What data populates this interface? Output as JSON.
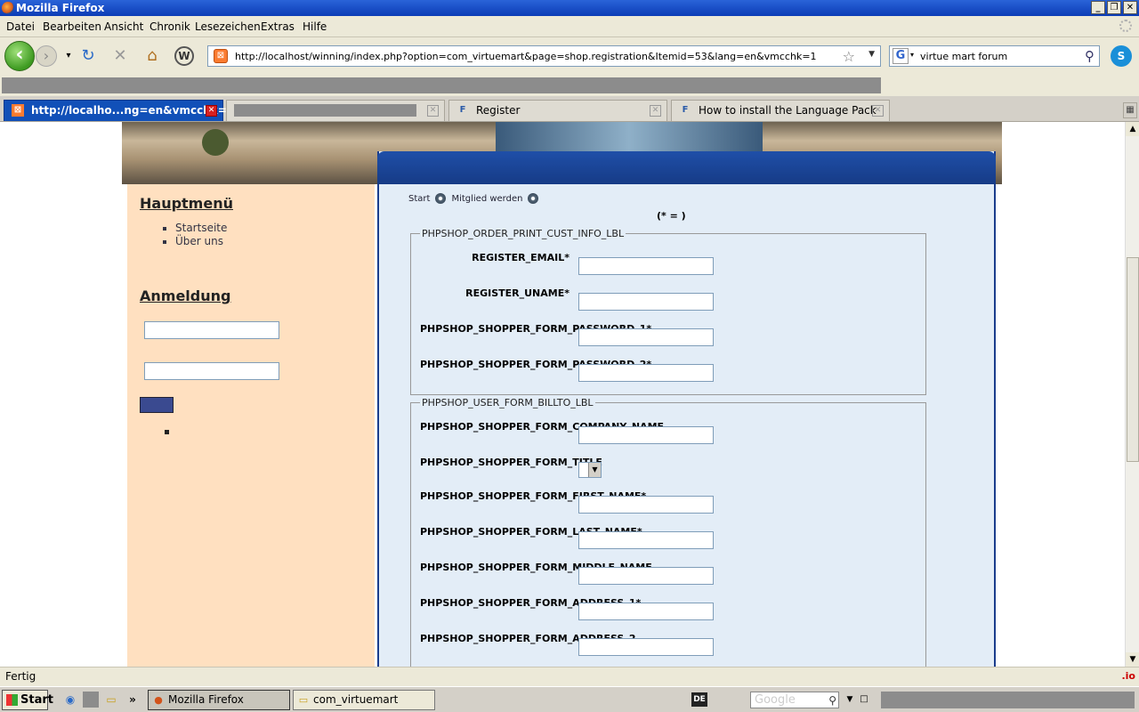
{
  "window": {
    "title": "Mozilla Firefox"
  },
  "menu": [
    "Datei",
    "Bearbeiten",
    "Ansicht",
    "Chronik",
    "Lesezeichen",
    "Extras",
    "Hilfe"
  ],
  "navbar": {
    "url": "http://localhost/winning/index.php?option=com_virtuemart&page=shop.registration&Itemid=53&lang=en&vmcchk=1",
    "search_value": "virtue mart forum"
  },
  "tabs": [
    {
      "label": "http://localho...ng=en&vmcchk=1",
      "active": true
    },
    {
      "label": "",
      "active": false
    },
    {
      "label": "Register",
      "active": false
    },
    {
      "label": "How to install the Language Pack",
      "active": false
    }
  ],
  "sidebar": {
    "main_menu_title": "Hauptmenü",
    "items": [
      "Startseite",
      "Über uns"
    ],
    "login_title": "Anmeldung"
  },
  "main": {
    "breadcrumb": [
      "Start",
      "Mitglied werden"
    ],
    "required_note": "(* = )",
    "fieldset1": {
      "legend": "PHPSHOP_ORDER_PRINT_CUST_INFO_LBL",
      "fields": [
        "REGISTER_EMAIL*",
        "REGISTER_UNAME*",
        "PHPSHOP_SHOPPER_FORM_PASSWORD_1*",
        "PHPSHOP_SHOPPER_FORM_PASSWORD_2*"
      ]
    },
    "fieldset2": {
      "legend": "PHPSHOP_USER_FORM_BILLTO_LBL",
      "fields": [
        "PHPSHOP_SHOPPER_FORM_COMPANY_NAME",
        "PHPSHOP_SHOPPER_FORM_TITLE",
        "PHPSHOP_SHOPPER_FORM_FIRST_NAME*",
        "PHPSHOP_SHOPPER_FORM_LAST_NAME*",
        "PHPSHOP_SHOPPER_FORM_MIDDLE_NAME",
        "PHPSHOP_SHOPPER_FORM_ADDRESS_1*",
        "PHPSHOP_SHOPPER_FORM_ADDRESS_2"
      ]
    }
  },
  "status": {
    "text": "Fertig",
    "addon": ".io"
  },
  "taskbar": {
    "start": "Start",
    "tasks": [
      "Mozilla Firefox",
      "com_virtuemart"
    ],
    "lang": "DE",
    "google": "Google"
  },
  "colors": {
    "titlebar": "#0b3cb6",
    "sidebar_bg": "#ffe0c0",
    "main_bg": "#e3edf7",
    "accent": "#1a3c8c"
  }
}
